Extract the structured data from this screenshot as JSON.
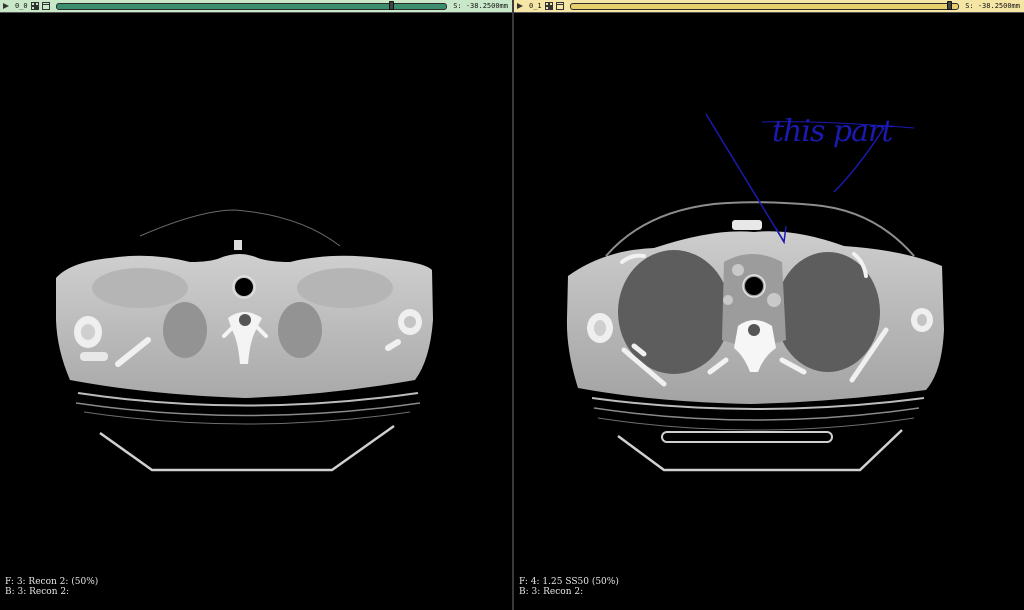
{
  "viewports": [
    {
      "id_label": "0_0",
      "slice_position": "S: -38.2500mm",
      "slice_fraction": 0.86,
      "toolbar_color": "#c9e8c9",
      "front_series": "F: 3: Recon 2: (50%)",
      "back_series": "B: 3: Recon 2:"
    },
    {
      "id_label": "0_1",
      "slice_position": "S: -38.2500mm",
      "slice_fraction": 0.98,
      "toolbar_color": "#f6e6a6",
      "front_series": "F: 4: 1.25 SS50 (50%)",
      "back_series": "B: 3: Recon 2:"
    }
  ],
  "annotation": {
    "text": "this part",
    "color": "#1a1ab0"
  },
  "icons": [
    "menu-icon",
    "layout-icon",
    "window-icon"
  ]
}
